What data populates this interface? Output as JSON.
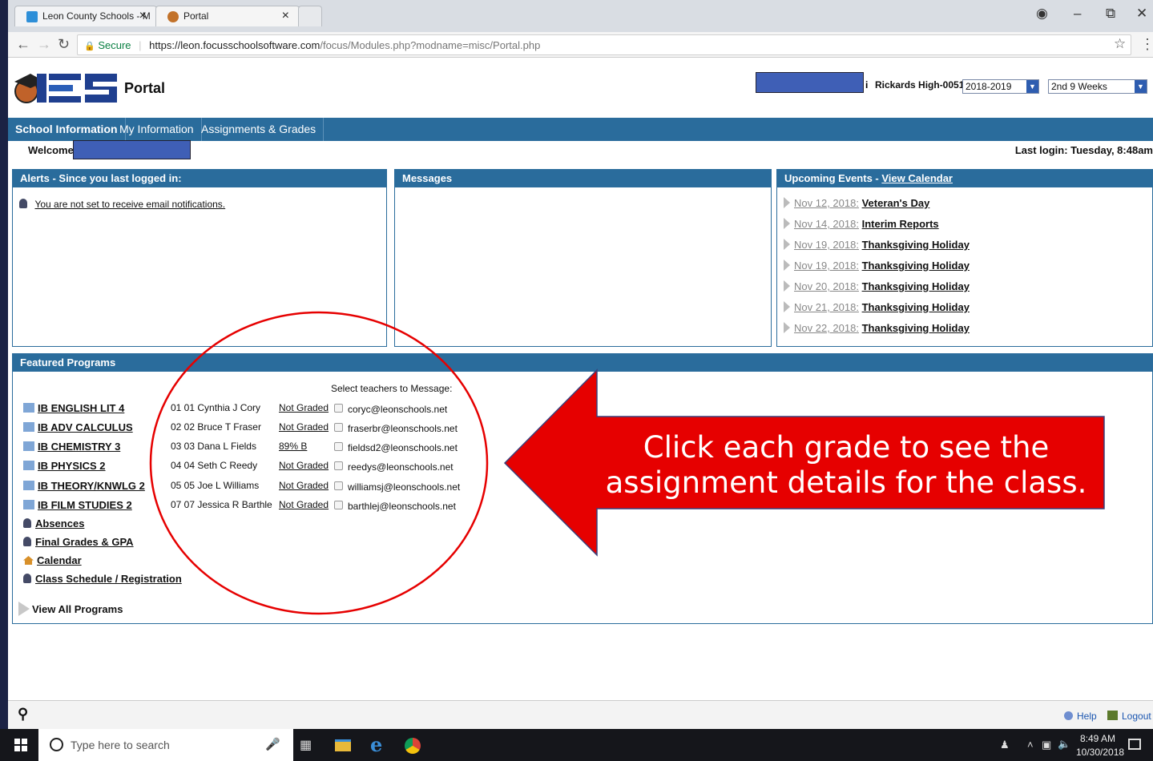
{
  "browser": {
    "tabs": [
      {
        "title": "Leon County Schools - M"
      },
      {
        "title": "Portal"
      }
    ],
    "secure_label": "Secure",
    "url_domain": "https://leon.focusschoolsoftware.com",
    "url_path": "/focus/Modules.php?modname=misc/Portal.php"
  },
  "header": {
    "title": "Portal",
    "school": "Rickards High-0051",
    "year": "2018-2019",
    "period": "2nd 9 Weeks"
  },
  "nav": {
    "tabs": [
      "School Information",
      "My Information",
      "Assignments & Grades"
    ]
  },
  "welcome": "Welcome,",
  "last_login": "Last login: Tuesday, 8:48am",
  "alerts": {
    "title": "Alerts - Since you last logged in:",
    "items": [
      "You are not set to receive email notifications."
    ]
  },
  "messages": {
    "title": "Messages"
  },
  "events": {
    "title": "Upcoming Events - ",
    "calendar_link": "View Calendar",
    "items": [
      {
        "date": "Nov 12, 2018:",
        "name": "Veteran's Day"
      },
      {
        "date": "Nov 14, 2018:",
        "name": "Interim Reports"
      },
      {
        "date": "Nov 19, 2018:",
        "name": "Thanksgiving Holiday"
      },
      {
        "date": "Nov 19, 2018:",
        "name": "Thanksgiving Holiday"
      },
      {
        "date": "Nov 20, 2018:",
        "name": "Thanksgiving Holiday"
      },
      {
        "date": "Nov 21, 2018:",
        "name": "Thanksgiving Holiday"
      },
      {
        "date": "Nov 22, 2018:",
        "name": "Thanksgiving Holiday"
      }
    ]
  },
  "featured": {
    "title": "Featured Programs",
    "select_label": "Select teachers to Message:",
    "courses": [
      {
        "name": "IB ENGLISH LIT 4",
        "teacher": "01 01 Cynthia J Cory",
        "grade": "Not Graded",
        "email": "coryc@leonschools.net"
      },
      {
        "name": "IB ADV CALCULUS",
        "teacher": "02 02 Bruce T Fraser",
        "grade": "Not Graded",
        "email": "fraserbr@leonschools.net"
      },
      {
        "name": "IB CHEMISTRY 3",
        "teacher": "03 03 Dana L Fields",
        "grade": "89% B",
        "email": "fieldsd2@leonschools.net"
      },
      {
        "name": "IB PHYSICS 2",
        "teacher": "04 04 Seth C Reedy",
        "grade": "Not Graded",
        "email": "reedys@leonschools.net"
      },
      {
        "name": "IB THEORY/KNWLG 2",
        "teacher": "05 05 Joe L Williams",
        "grade": "Not Graded",
        "email": "williamsj@leonschools.net"
      },
      {
        "name": "IB FILM STUDIES 2",
        "teacher": "07 07 Jessica R Barthle",
        "grade": "Not Graded",
        "email": "barthlej@leonschools.net"
      }
    ],
    "programs": [
      "Absences",
      "Final Grades & GPA",
      "Calendar",
      "Class Schedule / Registration"
    ],
    "view_all": "View All Programs"
  },
  "footer": {
    "help": "Help",
    "logout": "Logout"
  },
  "callout": {
    "text": "Click each grade to see the assignment details for the class.",
    "color": "#e60000"
  },
  "taskbar": {
    "search_placeholder": "Type here to search",
    "time": "8:49 AM",
    "date": "10/30/2018"
  }
}
